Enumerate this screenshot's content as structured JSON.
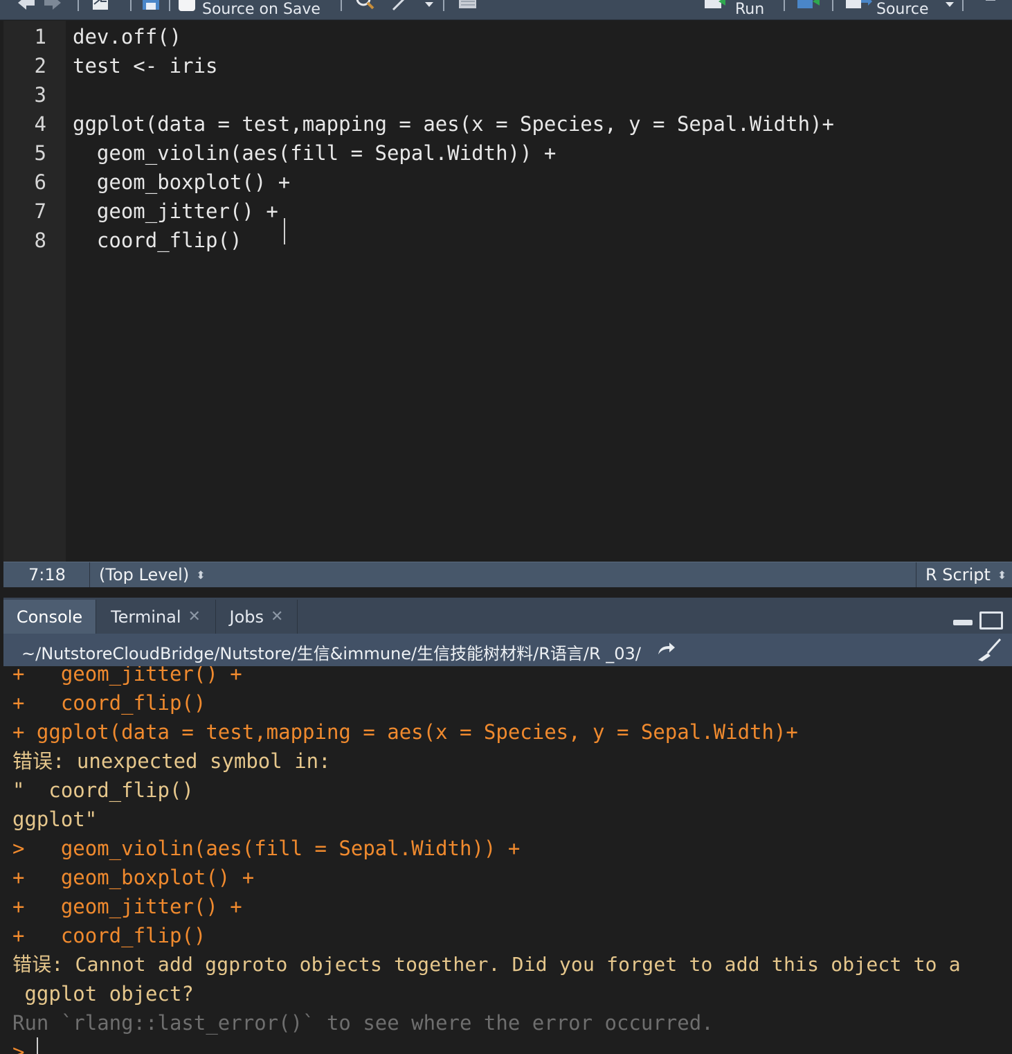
{
  "toolbar": {
    "source_on_save": "Source on Save",
    "run": "Run",
    "source": "Source"
  },
  "editor": {
    "line_numbers": [
      "1",
      "2",
      "3",
      "4",
      "5",
      "6",
      "7",
      "8"
    ],
    "lines": [
      "dev.off()",
      "test <- iris",
      "",
      "ggplot(data = test,mapping = aes(x = Species, y = Sepal.Width)+",
      "  geom_violin(aes(fill = Sepal.Width)) +",
      "  geom_boxplot() +",
      "  geom_jitter() +",
      "  coord_flip()"
    ]
  },
  "status": {
    "position": "7:18",
    "scope": "(Top Level)",
    "file_type": "R Script"
  },
  "tabs": [
    {
      "label": "Console"
    },
    {
      "label": "Terminal"
    },
    {
      "label": "Jobs"
    }
  ],
  "path": "~/NutstoreCloudBridge/Nutstore/生信&immune/生信技能树材料/R语言/R _03/",
  "console": {
    "lines": [
      {
        "text": "+   geom_jitter() +",
        "kind": "in"
      },
      {
        "text": "+   coord_flip()",
        "kind": "in"
      },
      {
        "text": "+ ggplot(data = test,mapping = aes(x = Species, y = Sepal.Width)+",
        "kind": "in"
      },
      {
        "text": "错误: unexpected symbol in:",
        "kind": "err"
      },
      {
        "text": "\"  coord_flip()",
        "kind": "err"
      },
      {
        "text": "ggplot\"",
        "kind": "err"
      },
      {
        "text": ">   geom_violin(aes(fill = Sepal.Width)) +",
        "kind": "in"
      },
      {
        "text": "+   geom_boxplot() +",
        "kind": "in"
      },
      {
        "text": "+   geom_jitter() +",
        "kind": "in"
      },
      {
        "text": "+   coord_flip()",
        "kind": "in"
      },
      {
        "text": "错误: Cannot add ggproto objects together. Did you forget to add this object to a",
        "kind": "err"
      },
      {
        "text": " ggplot object?",
        "kind": "err"
      },
      {
        "text": "Run `rlang::last_error()` to see where the error occurred.",
        "kind": "dim"
      },
      {
        "text": ">",
        "kind": "in"
      }
    ]
  }
}
